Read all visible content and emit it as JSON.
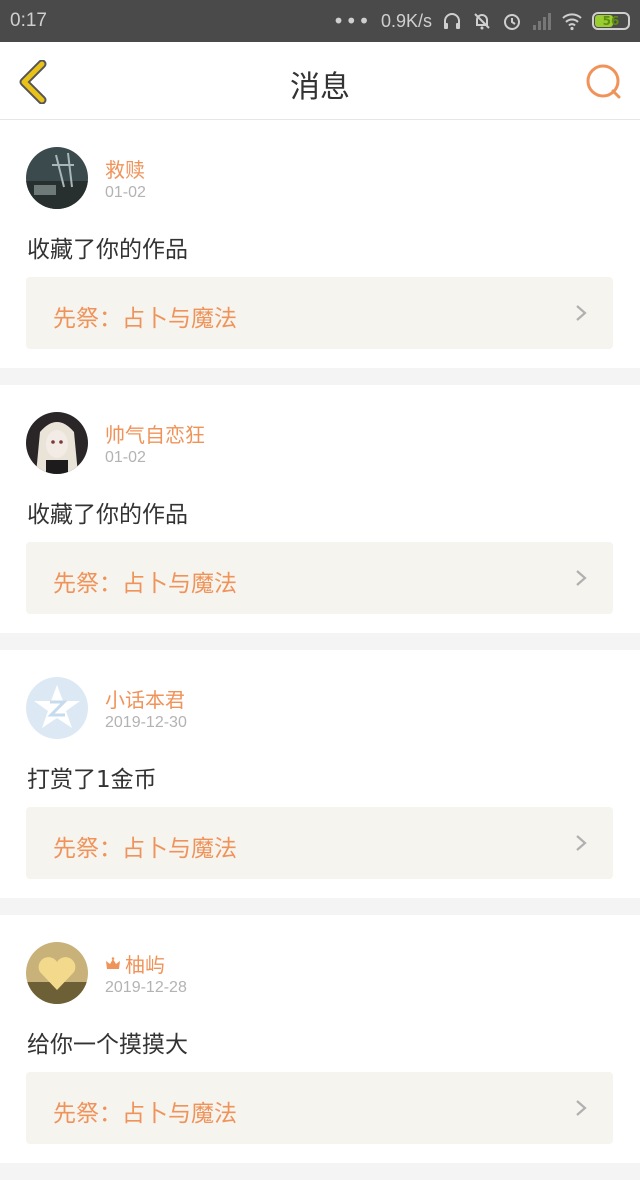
{
  "status_bar": {
    "time": "0:17",
    "dots": "•••",
    "speed": "0.9K/s",
    "battery": "56"
  },
  "nav": {
    "title": "消息"
  },
  "messages": [
    {
      "name": "救赎",
      "date": "01-02",
      "action": "收藏了你的作品",
      "work": "先祭：占卜与魔法",
      "crown": false
    },
    {
      "name": "帅气自恋狂",
      "date": "01-02",
      "action": "收藏了你的作品",
      "work": "先祭：占卜与魔法",
      "crown": false
    },
    {
      "name": "小话本君",
      "date": "2019-12-30",
      "action": "打赏了1金币",
      "work": "先祭：占卜与魔法",
      "crown": false
    },
    {
      "name": "柚屿",
      "date": "2019-12-28",
      "action": "给你一个摸摸大",
      "work": "先祭：占卜与魔法",
      "crown": true
    }
  ],
  "colors": {
    "accent": "#f0935a",
    "back_icon": "#e8c21a",
    "search_icon": "#f0935a"
  }
}
